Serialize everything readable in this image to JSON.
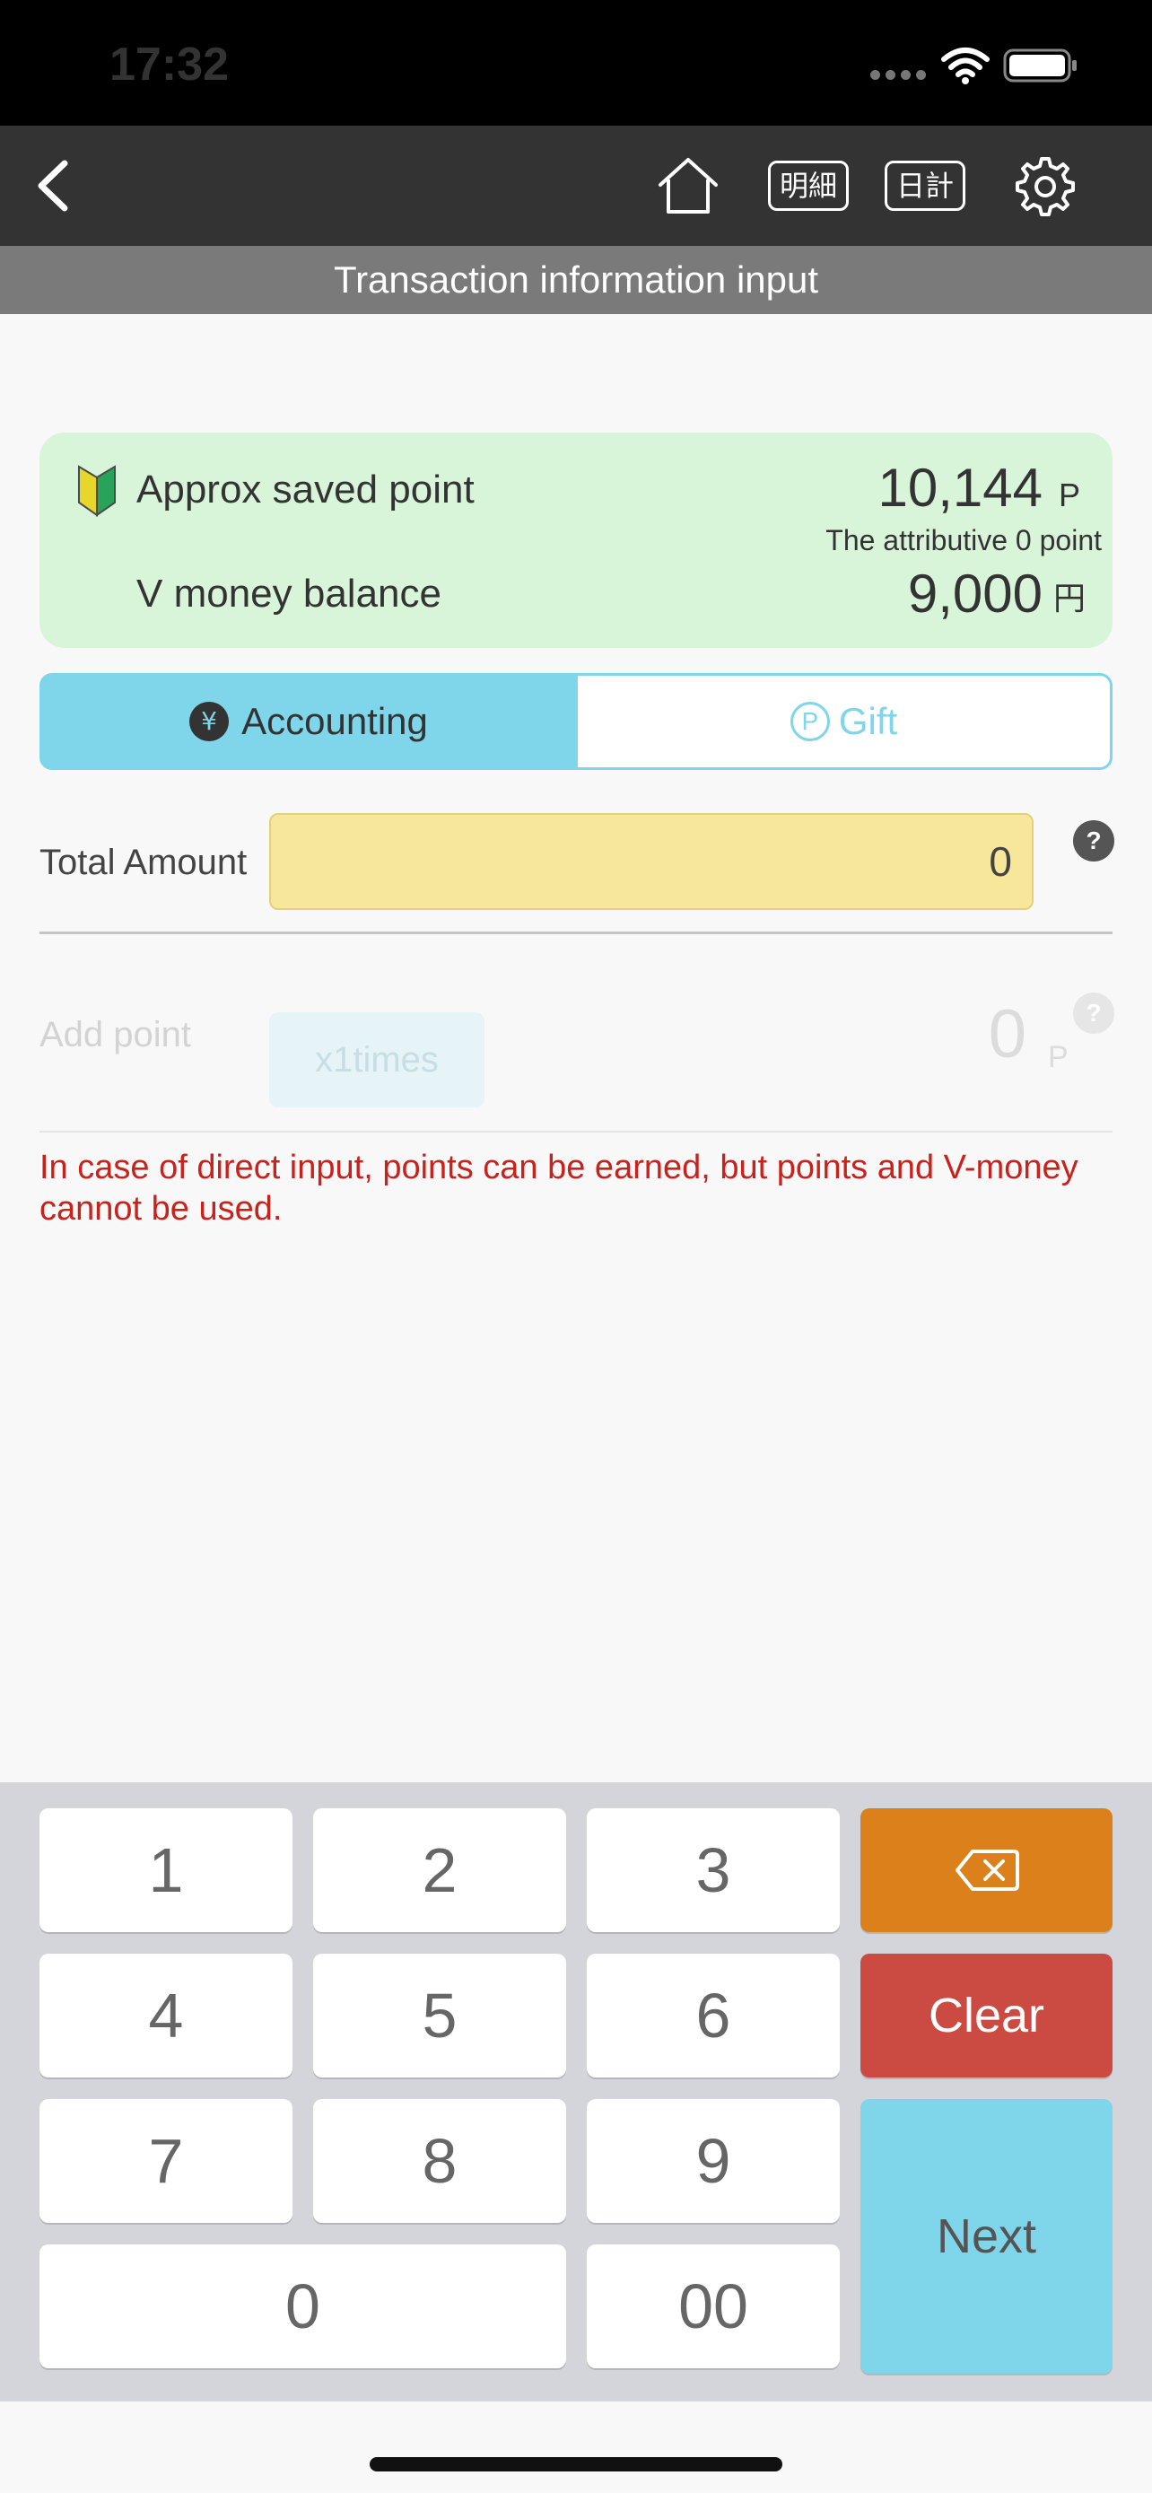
{
  "status_bar": {
    "time": "17:32"
  },
  "nav": {
    "detail_label": "明細",
    "daily_label": "日計"
  },
  "page_title": "Transaction information input",
  "balance": {
    "points_label": "Approx saved point",
    "points_value": "10,144",
    "points_unit": "P",
    "attributive_text": "The attributive 0 point",
    "vmoney_label": "V money balance",
    "vmoney_value": "9,000",
    "vmoney_unit": "円"
  },
  "tabs": {
    "accounting_icon": "¥",
    "accounting_label": "Accounting",
    "gift_icon": "P",
    "gift_label": "Gift"
  },
  "total": {
    "label": "Total Amount",
    "value": "0",
    "help": "?"
  },
  "add_point": {
    "label": "Add point",
    "multiplier": "x1times",
    "value": "0",
    "unit": "P",
    "help": "?"
  },
  "notice": "In case of direct input, points can be earned, but points and V-money cannot be used.",
  "keypad": {
    "k1": "1",
    "k2": "2",
    "k3": "3",
    "k4": "4",
    "k5": "5",
    "k6": "6",
    "k7": "7",
    "k8": "8",
    "k9": "9",
    "k0": "0",
    "k00": "00",
    "clear": "Clear",
    "next": "Next"
  },
  "colors": {
    "accent": "#7fd5ea",
    "card_green": "#d9f5d9",
    "input_yellow": "#f7e79a",
    "backspace": "#db801a",
    "clear": "#cb4a41",
    "notice_red": "#c8221d"
  },
  "icons": [
    "back-chevron-icon",
    "home-icon",
    "gear-icon",
    "beginner-mark-icon",
    "backspace-icon",
    "wifi-icon",
    "battery-icon"
  ]
}
